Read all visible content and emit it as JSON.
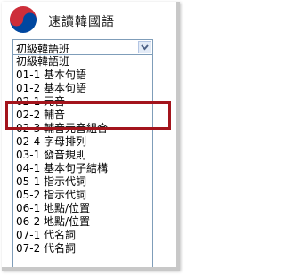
{
  "app": {
    "title": "速讀韓國語",
    "logo_icon": "korean-flag-taegeuk-icon",
    "logo_colors": {
      "red": "#cd2e3a",
      "blue": "#0047a0"
    }
  },
  "select": {
    "selected_value": "初級韓語班",
    "arrow_icon": "chevron-down-icon"
  },
  "list": {
    "items": [
      "初級韓語班",
      "01-1 基本句語",
      "01-2 基本句語",
      "02-1 元音",
      "02-2 輔音",
      "02-3 輔音元音組合",
      "02-4 字母排列",
      "03-1 發音規則",
      "04-1 基本句子結構",
      "05-1 指示代詞",
      "05-2 指示代詞",
      "06-1 地點/位置",
      "06-2 地點/位置",
      "07-1 代名詞",
      "07-2 代名詞"
    ]
  },
  "colors": {
    "highlight_border": "#a3141c",
    "select_border": "#7f9db9"
  }
}
